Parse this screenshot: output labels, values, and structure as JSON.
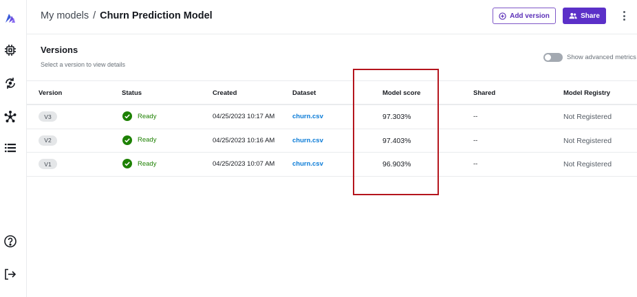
{
  "header": {
    "breadcrumb_parent": "My models",
    "breadcrumb_separator": "/",
    "breadcrumb_current": "Churn Prediction Model",
    "add_version_label": "Add version",
    "share_label": "Share"
  },
  "versions": {
    "title": "Versions",
    "subtitle": "Select a version to view details",
    "toggle_label": "Show advanced metrics"
  },
  "table": {
    "columns": {
      "version": "Version",
      "status": "Status",
      "created": "Created",
      "dataset": "Dataset",
      "score": "Model score",
      "shared": "Shared",
      "registry": "Model Registry"
    },
    "rows": [
      {
        "version": "V3",
        "status": "Ready",
        "created": "04/25/2023 10:17 AM",
        "dataset": "churn.csv",
        "score": "97.303%",
        "shared": "--",
        "registry": "Not Registered"
      },
      {
        "version": "V2",
        "status": "Ready",
        "created": "04/25/2023 10:16 AM",
        "dataset": "churn.csv",
        "score": "97.403%",
        "shared": "--",
        "registry": "Not Registered"
      },
      {
        "version": "V1",
        "status": "Ready",
        "created": "04/25/2023 10:07 AM",
        "dataset": "churn.csv",
        "score": "96.903%",
        "shared": "--",
        "registry": "Not Registered"
      }
    ]
  },
  "sidebar": {
    "icons": [
      "canvas-logo-icon",
      "chip-icon",
      "data-refresh-icon",
      "hub-icon",
      "list-icon",
      "help-icon",
      "logout-icon"
    ]
  },
  "colors": {
    "accent": "#5b30c8",
    "ready_green": "#1d8102",
    "link_blue": "#0a7bd7",
    "highlight_red": "#b4141c"
  }
}
